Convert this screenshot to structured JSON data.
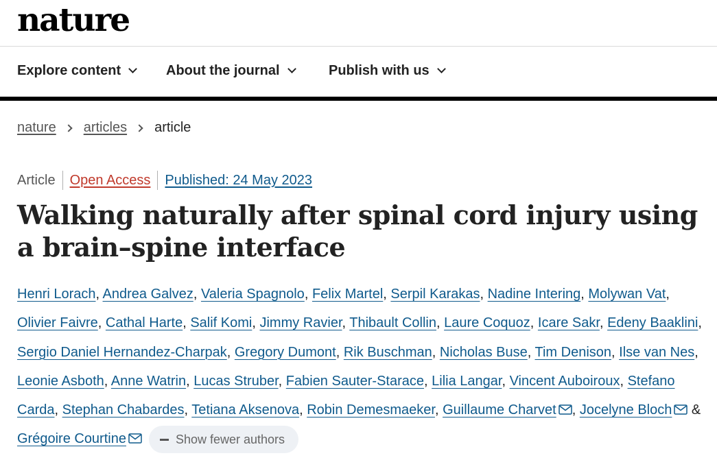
{
  "header": {
    "logo": "nature"
  },
  "nav": {
    "items": [
      {
        "label": "Explore content"
      },
      {
        "label": "About the journal"
      },
      {
        "label": "Publish with us"
      }
    ]
  },
  "breadcrumb": {
    "items": [
      "nature",
      "articles"
    ],
    "current": "article"
  },
  "meta": {
    "article_type": "Article",
    "access": "Open Access",
    "published": "Published: 24 May 2023"
  },
  "article": {
    "title": "Walking naturally after spinal cord injury using a brain–spine interface"
  },
  "authors": {
    "list": [
      "Henri Lorach",
      "Andrea Galvez",
      "Valeria Spagnolo",
      "Felix Martel",
      "Serpil Karakas",
      "Nadine Intering",
      "Molywan Vat",
      "Olivier Faivre",
      "Cathal Harte",
      "Salif Komi",
      "Jimmy Ravier",
      "Thibault Collin",
      "Laure Coquoz",
      "Icare Sakr",
      "Edeny Baaklini",
      "Sergio Daniel Hernandez-Charpak",
      "Gregory Dumont",
      "Rik Buschman",
      "Nicholas Buse",
      "Tim Denison",
      "Ilse van Nes",
      "Leonie Asboth",
      "Anne Watrin",
      "Lucas Struber",
      "Fabien Sauter-Starace",
      "Lilia Langar",
      "Vincent Auboiroux",
      "Stefano Carda",
      "Stephan Chabardes",
      "Tetiana Aksenova",
      "Robin Demesmaeker",
      "Guillaume Charvet",
      "Jocelyne Bloch",
      "Grégoire Courtine"
    ],
    "separator": ", ",
    "ampersand": " & ",
    "corresponding": [
      "Guillaume Charvet",
      "Jocelyne Bloch",
      "Grégoire Courtine"
    ],
    "show_fewer_label": "Show fewer authors"
  },
  "colors": {
    "link": "#0f5a8c",
    "open_access": "#c0392b",
    "text": "#222222",
    "pill_bg": "#eef1f5"
  }
}
